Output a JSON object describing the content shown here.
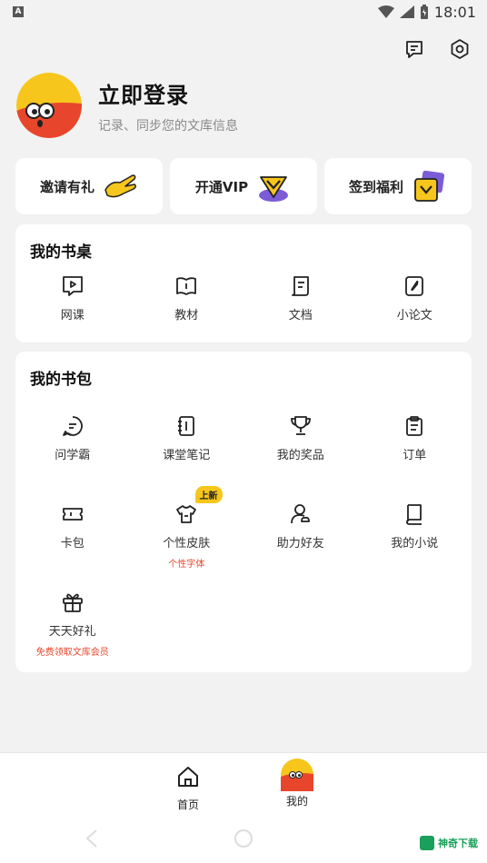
{
  "status_bar": {
    "left_icon": "A",
    "time": "18:01"
  },
  "header_icons": [
    "message-icon",
    "settings-icon"
  ],
  "profile": {
    "title": "立即登录",
    "subtitle": "记录、同步您的文库信息"
  },
  "quick_actions": [
    {
      "label": "邀请有礼",
      "icon": "hand-wave-icon"
    },
    {
      "label": "开通VIP",
      "icon": "vip-badge-icon"
    },
    {
      "label": "签到福利",
      "icon": "checkin-card-icon"
    }
  ],
  "desk": {
    "title": "我的书桌",
    "items": [
      {
        "label": "网课",
        "icon": "play-chat-icon"
      },
      {
        "label": "教材",
        "icon": "open-book-icon"
      },
      {
        "label": "文档",
        "icon": "document-icon"
      },
      {
        "label": "小论文",
        "icon": "pen-note-icon"
      }
    ]
  },
  "bag": {
    "title": "我的书包",
    "items": [
      {
        "label": "问学霸",
        "icon": "question-chat-icon",
        "sub": ""
      },
      {
        "label": "课堂笔记",
        "icon": "notebook-icon",
        "sub": ""
      },
      {
        "label": "我的奖品",
        "icon": "trophy-icon",
        "sub": ""
      },
      {
        "label": "订单",
        "icon": "clipboard-icon",
        "sub": ""
      },
      {
        "label": "卡包",
        "icon": "ticket-icon",
        "sub": ""
      },
      {
        "label": "个性皮肤",
        "icon": "tshirt-icon",
        "sub": "个性字体",
        "badge": "上新"
      },
      {
        "label": "助力好友",
        "icon": "friend-icon",
        "sub": ""
      },
      {
        "label": "我的小说",
        "icon": "novel-icon",
        "sub": ""
      },
      {
        "label": "天天好礼",
        "icon": "gift-icon",
        "sub": "免费领取文库会员"
      }
    ]
  },
  "bottom_nav": [
    {
      "label": "首页",
      "icon": "home-icon"
    },
    {
      "label": "我的",
      "icon": "mascot-avatar-icon"
    }
  ],
  "watermark": "神奇下载",
  "colors": {
    "accent_yellow": "#f7c61c",
    "accent_red": "#e8462c",
    "accent_purple": "#7b5cd6",
    "background": "#f2f2f2"
  }
}
